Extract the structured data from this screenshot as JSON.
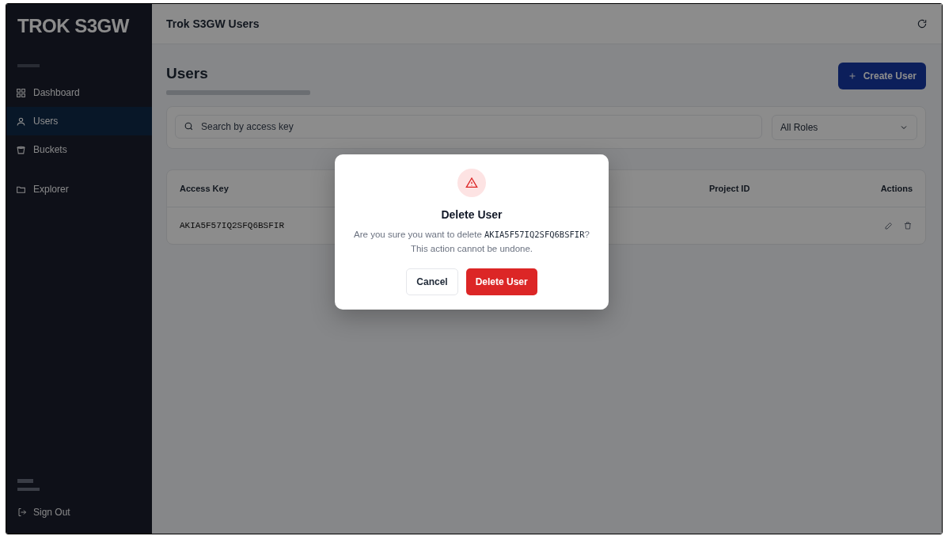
{
  "sidebar": {
    "logo": "TROK S3GW",
    "items": [
      {
        "label": "Dashboard",
        "selected": false,
        "kind": "nav"
      },
      {
        "label": "Users",
        "selected": true,
        "kind": "nav"
      },
      {
        "label": "Buckets",
        "selected": false,
        "kind": "nav"
      },
      {
        "label": "Explorer",
        "selected": false,
        "kind": "tool"
      }
    ],
    "sign_out": "Sign Out"
  },
  "header": {
    "title": "Trok S3GW Users"
  },
  "page": {
    "title": "Users",
    "create_button": "Create User"
  },
  "filters": {
    "search_placeholder": "Search by access key",
    "role_select": "All Roles"
  },
  "table": {
    "columns": [
      "Access Key",
      "Project ID",
      "Actions"
    ],
    "rows": [
      {
        "access_key": "AKIA5F57IQ2SFQ6BSFIR"
      }
    ]
  },
  "dialog": {
    "title": "Delete User",
    "message_before": "Are you sure you want to delete",
    "key": "AKIA5F57IQ2SFQ6BSFIR",
    "message_after": "? This action cannot be undone.",
    "buttons": [
      {
        "label": "Cancel",
        "kind": "secondary"
      },
      {
        "label": "Delete User",
        "kind": "danger"
      }
    ]
  }
}
